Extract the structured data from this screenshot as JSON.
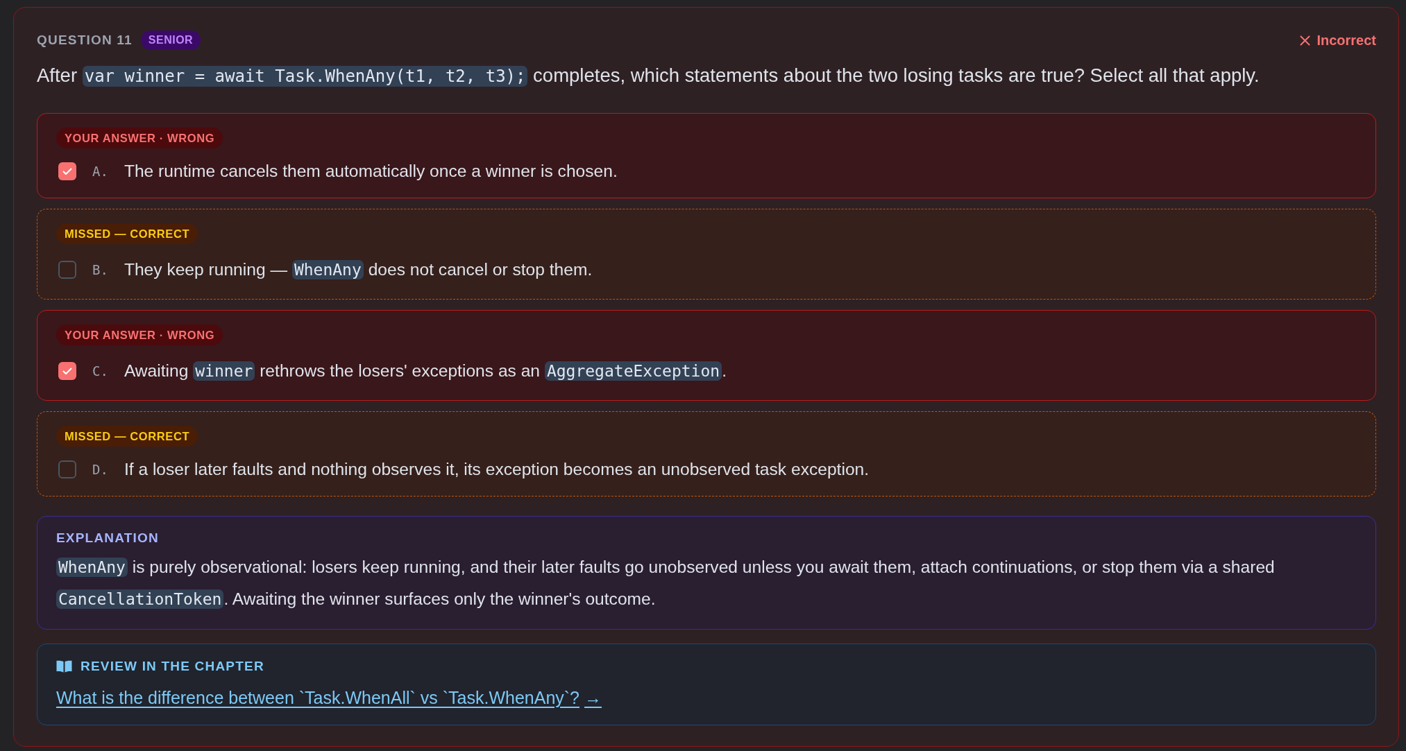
{
  "question": {
    "label": "QUESTION 11",
    "level_badge": "SENIOR",
    "result": {
      "text": "Incorrect",
      "correct": false
    },
    "prompt": [
      {
        "kind": "text",
        "text": "After "
      },
      {
        "kind": "code",
        "text": "var winner = await Task.WhenAny(t1, t2, t3);"
      },
      {
        "kind": "text",
        "text": " completes, which statements about the two losing tasks are true? Select all that apply."
      }
    ]
  },
  "options": [
    {
      "kind": "wrong",
      "badge": "YOUR ANSWER · WRONG",
      "checked": true,
      "letter": "A.",
      "segments": [
        {
          "kind": "text",
          "text": "The runtime cancels them automatically once a winner is chosen."
        }
      ]
    },
    {
      "kind": "missed",
      "badge": "MISSED — CORRECT",
      "checked": false,
      "letter": "B.",
      "segments": [
        {
          "kind": "text",
          "text": "They keep running — "
        },
        {
          "kind": "code",
          "text": "WhenAny"
        },
        {
          "kind": "text",
          "text": " does not cancel or stop them."
        }
      ]
    },
    {
      "kind": "wrong",
      "badge": "YOUR ANSWER · WRONG",
      "checked": true,
      "letter": "C.",
      "segments": [
        {
          "kind": "text",
          "text": "Awaiting "
        },
        {
          "kind": "code",
          "text": "winner"
        },
        {
          "kind": "text",
          "text": " rethrows the losers' exceptions as an "
        },
        {
          "kind": "code",
          "text": "AggregateException"
        },
        {
          "kind": "text",
          "text": "."
        }
      ]
    },
    {
      "kind": "missed",
      "badge": "MISSED — CORRECT",
      "checked": false,
      "letter": "D.",
      "segments": [
        {
          "kind": "text",
          "text": "If a loser later faults and nothing observes it, its exception becomes an unobserved task exception."
        }
      ]
    }
  ],
  "explanation": {
    "title": "EXPLANATION",
    "segments": [
      {
        "kind": "code",
        "text": "WhenAny"
      },
      {
        "kind": "text",
        "text": " is purely observational: losers keep running, and their later faults go unobserved unless you await them, attach continuations, or stop them via a shared "
      },
      {
        "kind": "code",
        "text": "CancellationToken"
      },
      {
        "kind": "text",
        "text": ". Awaiting the winner surfaces only the winner's outcome."
      }
    ]
  },
  "review": {
    "title": "REVIEW IN THE CHAPTER",
    "link": {
      "text": "What is the difference between `Task.WhenAll` vs `Task.WhenAny`?",
      "arrow": "→"
    }
  }
}
